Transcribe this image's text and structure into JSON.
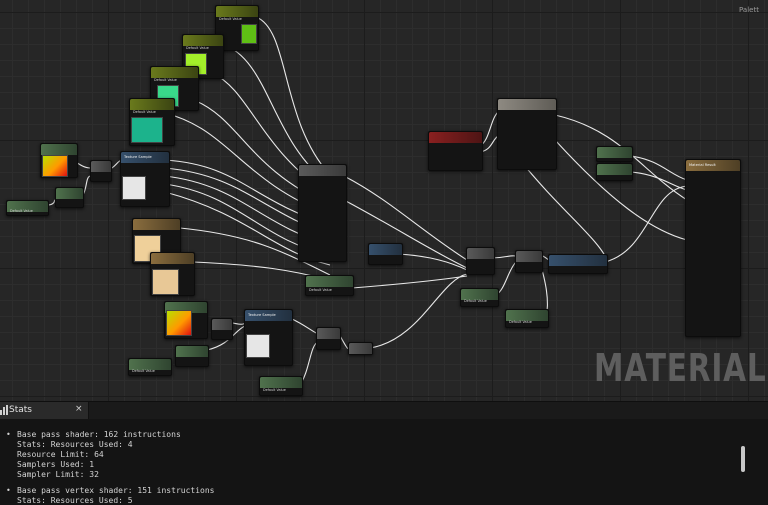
{
  "graph": {
    "watermark": "MATERIAL",
    "palette_tab_partial": "Palett"
  },
  "nodes": {
    "result_title": "Material Result",
    "default_value": "Default Value",
    "texture_sample_title": "Texture Sample"
  },
  "stats_panel": {
    "tab_label": "Stats",
    "close_symbol": "×",
    "lines": [
      "Base pass shader: 162 instructions",
      "Stats: Resources Used: 4",
      "Resource Limit: 64",
      "Samplers Used: 1",
      "Sampler Limit: 32",
      "Base pass vertex shader: 151 instructions",
      "Stats: Resources Used: 5"
    ],
    "bullet": "•"
  },
  "colors": {
    "graph_bg": "#262626",
    "panel_bg": "#141414",
    "wire": "#e8e8e8",
    "param_header": "#6a7a1c",
    "texture_header": "#36506c"
  }
}
